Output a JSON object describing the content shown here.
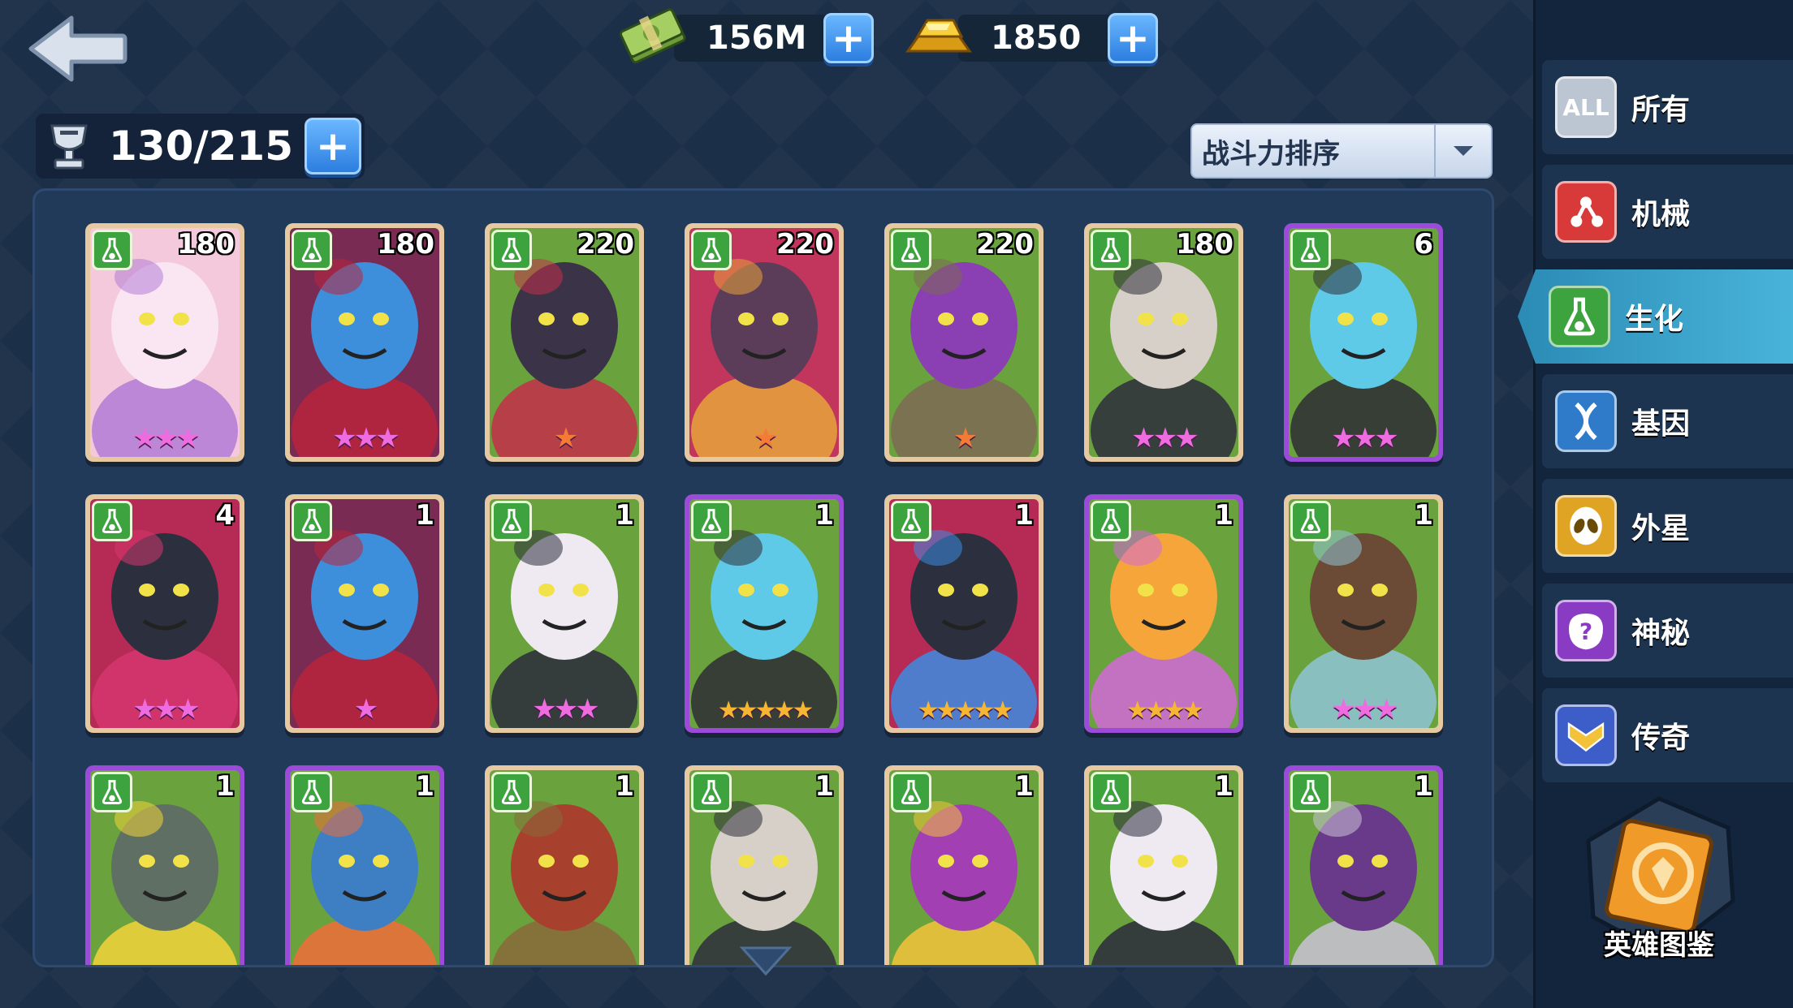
{
  "currencies": {
    "cash": {
      "value": "156M",
      "icon": "cash-bundle-icon"
    },
    "gold": {
      "value": "1850",
      "icon": "gold-bar-icon"
    }
  },
  "capacity": {
    "value": "130/215",
    "icon": "trophy-icon"
  },
  "sort": {
    "label": "战斗力排序"
  },
  "plus_label": "+",
  "sidebar": {
    "all_badge": "ALL",
    "items": [
      {
        "label": "所有",
        "color": "#bcc6d2"
      },
      {
        "label": "机械",
        "color": "#d83a3a"
      },
      {
        "label": "生化",
        "color": "#3ca33f"
      },
      {
        "label": "基因",
        "color": "#2f7ac9"
      },
      {
        "label": "外星",
        "color": "#e0a424"
      },
      {
        "label": "神秘",
        "color": "#8a3bc4"
      },
      {
        "label": "传奇",
        "color": "#3d5ec9"
      }
    ],
    "active_index": 2,
    "codex_label": "英雄图鉴"
  },
  "heroes": [
    {
      "level": "180",
      "stars": "★★★",
      "star_color": "pink",
      "frame": "tan",
      "bg": "#f4c9dc",
      "char": "#f9e6f2",
      "accent": "#b37bd6"
    },
    {
      "level": "180",
      "stars": "★★★",
      "star_color": "pink",
      "frame": "tan",
      "bg": "#7a2b54",
      "char": "#3e8fdb",
      "accent": "#b8253c"
    },
    {
      "level": "220",
      "stars": "★",
      "star_color": "orange",
      "frame": "tan",
      "bg": "#6aa23d",
      "char": "#3b3347",
      "accent": "#c42f4a"
    },
    {
      "level": "220",
      "stars": "★",
      "star_color": "orange",
      "frame": "tan",
      "bg": "#c2355c",
      "char": "#5b3d5a",
      "accent": "#e7a33a"
    },
    {
      "level": "220",
      "stars": "★",
      "star_color": "orange",
      "frame": "tan",
      "bg": "#6aa23d",
      "char": "#8a3fb3",
      "accent": "#7c6a53"
    },
    {
      "level": "180",
      "stars": "★★★",
      "star_color": "pink",
      "frame": "tan",
      "bg": "#6aa23d",
      "char": "#d7d0c8",
      "accent": "#2e2e3d"
    },
    {
      "level": "6",
      "stars": "★★★",
      "star_color": "pink",
      "frame": "purple",
      "bg": "#6aa23d",
      "char": "#5fc9e8",
      "accent": "#2d2d35"
    },
    {
      "level": "4",
      "stars": "★★★",
      "star_color": "pink",
      "frame": "tan",
      "bg": "#b52b55",
      "char": "#2c2f3e",
      "accent": "#d6366e"
    },
    {
      "level": "1",
      "stars": "★",
      "star_color": "pink",
      "frame": "tan",
      "bg": "#7a2b54",
      "char": "#3e8fdb",
      "accent": "#b8253c"
    },
    {
      "level": "1",
      "stars": "★★★",
      "star_color": "pink",
      "frame": "tan",
      "bg": "#6aa23d",
      "char": "#efeaf2",
      "accent": "#2a2b3c"
    },
    {
      "level": "1",
      "stars": "★★★★★",
      "star_color": "gold",
      "frame": "purple",
      "bg": "#6aa23d",
      "char": "#5fc9e8",
      "accent": "#2d2d35"
    },
    {
      "level": "1",
      "stars": "★★★★★",
      "star_color": "gold",
      "frame": "tan",
      "bg": "#b52b55",
      "char": "#2c2f3e",
      "accent": "#3d8be0"
    },
    {
      "level": "1",
      "stars": "★★★★",
      "star_color": "gold",
      "frame": "purple",
      "bg": "#6aa23d",
      "char": "#f5a53a",
      "accent": "#d16ad8"
    },
    {
      "level": "1",
      "stars": "★★★",
      "star_color": "pink",
      "frame": "tan",
      "bg": "#6aa23d",
      "char": "#6b4a36",
      "accent": "#8fc4d6"
    },
    {
      "level": "1",
      "stars": "",
      "star_color": "pink",
      "frame": "purple",
      "bg": "#6aa23d",
      "char": "#5f6f63",
      "accent": "#f2d33a"
    },
    {
      "level": "1",
      "stars": "",
      "star_color": "pink",
      "frame": "purple",
      "bg": "#6aa23d",
      "char": "#3e7fc3",
      "accent": "#ee6d3a"
    },
    {
      "level": "1",
      "stars": "",
      "star_color": "pink",
      "frame": "tan",
      "bg": "#6aa23d",
      "char": "#a8402e",
      "accent": "#8a6a3a"
    },
    {
      "level": "1",
      "stars": "",
      "star_color": "pink",
      "frame": "tan",
      "bg": "#6aa23d",
      "char": "#d7d0c8",
      "accent": "#2e2e3d"
    },
    {
      "level": "1",
      "stars": "",
      "star_color": "pink",
      "frame": "tan",
      "bg": "#6aa23d",
      "char": "#a23fb3",
      "accent": "#f2c33a"
    },
    {
      "level": "1",
      "stars": "",
      "star_color": "pink",
      "frame": "tan",
      "bg": "#6aa23d",
      "char": "#efeaf2",
      "accent": "#2a2b3c"
    },
    {
      "level": "1",
      "stars": "",
      "star_color": "pink",
      "frame": "purple",
      "bg": "#6aa23d",
      "char": "#6a3a8a",
      "accent": "#c9c2d6"
    }
  ]
}
